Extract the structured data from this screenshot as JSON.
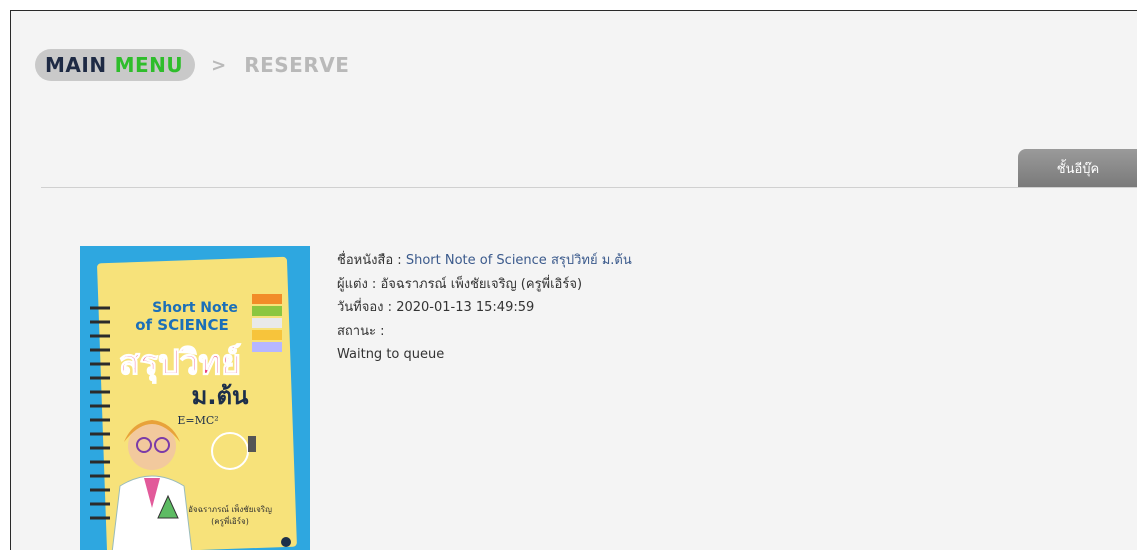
{
  "breadcrumb": {
    "main": "MAIN",
    "menu": "MENU",
    "separator": ">",
    "current": "RESERVE"
  },
  "tabs": {
    "ebook": "ชั้นอีบุ๊ค"
  },
  "book": {
    "title_label": "ชื่อหนังสือ : ",
    "title": "Short Note of Science สรุปวิทย์ ม.ต้น",
    "author_label": "ผู้แต่ง : ",
    "author": "อัจฉราภรณ์ เพ็งชัยเจริญ (ครูพี่เอิร์จ)",
    "date_label": "วันที่จอง : ",
    "date": "2020-01-13 15:49:59",
    "status_label": "สถานะ :",
    "status": "Waitng to queue"
  },
  "cover": {
    "line1": "Short Note",
    "line2": "of SCIENCE",
    "line3": "สรุปวิทย์",
    "line4": "ม.ต้น",
    "formula": "E=MC²",
    "author1": "อัจฉราภรณ์ เพ็งชัยเจริญ",
    "author2": "(ครูพี่เอิร์จ)"
  },
  "colors": {
    "pill": "#c9c9c9",
    "main_text": "#1e2a44",
    "menu_text": "#2ebd2b",
    "link": "#3b5a8c",
    "cover_blue": "#2ea7e0",
    "notebook": "#f7e27a"
  }
}
